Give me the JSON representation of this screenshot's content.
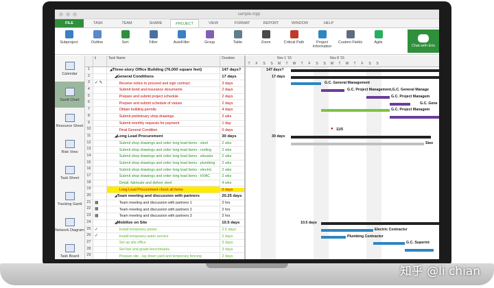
{
  "window": {
    "title": "sample.mpp"
  },
  "ribbon_tabs": [
    "FILE",
    "TASK",
    "TEAM",
    "SHARE",
    "PROJECT",
    "VIEW",
    "FORMAT",
    "REPORT",
    "WINDOW",
    "HELP"
  ],
  "active_tab": "PROJECT",
  "ribbon_buttons": [
    {
      "label": "Subproject",
      "icon": "subproject-icon"
    },
    {
      "label": "Outline",
      "icon": "outline-icon"
    },
    {
      "label": "Sort",
      "icon": "sort-icon"
    },
    {
      "label": "Filter",
      "icon": "filter-icon"
    },
    {
      "label": "AutoFilter",
      "icon": "autofilter-icon"
    },
    {
      "label": "Group",
      "icon": "group-icon"
    },
    {
      "label": "Table",
      "icon": "table-icon"
    },
    {
      "label": "Zoom",
      "icon": "zoom-icon"
    },
    {
      "label": "Critical Path",
      "icon": "critical-path-icon"
    },
    {
      "label": "Project Information",
      "icon": "project-info-icon"
    },
    {
      "label": "Custom Fields",
      "icon": "custom-fields-icon"
    },
    {
      "label": "Agile",
      "icon": "agile-icon"
    }
  ],
  "chat": {
    "label": "Chat with Eris"
  },
  "side_views": [
    "Calendar",
    "Gantt Chart",
    "Resource Sheet",
    "Risk View",
    "Task Sheet",
    "Tracking Gantt",
    "Network Diagram",
    "Task Board"
  ],
  "active_view": "Gantt Chart",
  "grid": {
    "col_task": "Task Name",
    "col_duration": "Duration",
    "rows": [
      {
        "id": "1",
        "name": "Three-story Office Building (76,000 square feet)",
        "duration": "147 days?",
        "style": "summary",
        "indent": 0
      },
      {
        "id": "2",
        "name": "General Conditions",
        "duration": "17 days",
        "style": "summary",
        "indent": 1
      },
      {
        "id": "3",
        "name": "Receive notice to proceed and sign contract",
        "duration": "3 days",
        "style": "red",
        "indent": 2
      },
      {
        "id": "4",
        "name": "Submit bond and insurance documents",
        "duration": "2 days",
        "style": "red",
        "indent": 2
      },
      {
        "id": "5",
        "name": "Prepare and submit project schedule",
        "duration": "2 days",
        "style": "red",
        "indent": 2
      },
      {
        "id": "6",
        "name": "Prepare and submit schedule of values",
        "duration": "2 days",
        "style": "red",
        "indent": 2
      },
      {
        "id": "7",
        "name": "Obtain building permits",
        "duration": "4 days",
        "style": "red",
        "indent": 2
      },
      {
        "id": "8",
        "name": "Submit preliminary shop drawings",
        "duration": "2 wks",
        "style": "red",
        "indent": 2
      },
      {
        "id": "9",
        "name": "Submit monthly requests for payment",
        "duration": "1 day",
        "style": "red",
        "indent": 2
      },
      {
        "id": "10",
        "name": "Final General Condition",
        "duration": "0 days",
        "style": "red",
        "indent": 2
      },
      {
        "id": "11",
        "name": "Long Lead Procurement",
        "duration": "30 days",
        "style": "summary",
        "indent": 1
      },
      {
        "id": "12",
        "name": "Submit shop drawings and order long lead items - steel",
        "duration": "2 wks",
        "style": "green",
        "indent": 2
      },
      {
        "id": "13",
        "name": "Submit shop drawings and order long lead items - roofing",
        "duration": "2 wks",
        "style": "green",
        "indent": 2
      },
      {
        "id": "14",
        "name": "Submit shop drawings and order long lead items - elevator",
        "duration": "2 wks",
        "style": "green",
        "indent": 2
      },
      {
        "id": "15",
        "name": "Submit shop drawings and order long lead items - plumbing",
        "duration": "2 wks",
        "style": "green",
        "indent": 2
      },
      {
        "id": "16",
        "name": "Submit shop drawings and order long lead items - electric",
        "duration": "2 wks",
        "style": "green",
        "indent": 2
      },
      {
        "id": "17",
        "name": "Submit shop drawings and order long lead items - HVAC",
        "duration": "2 wks",
        "style": "green",
        "indent": 2
      },
      {
        "id": "18",
        "name": "Detail, fabricate and deliver steel",
        "duration": "4 wks",
        "style": "green",
        "indent": 2
      },
      {
        "id": "19",
        "name": "Long Lead Procurement check all items",
        "duration": "0 days",
        "style": "highlight",
        "indent": 2
      },
      {
        "id": "20",
        "name": "Team meeting and discussion with partners",
        "duration": "20.25 days",
        "style": "summary",
        "indent": 1
      },
      {
        "id": "21",
        "name": "Team meeting and discussion with partners 1",
        "duration": "2 hrs",
        "style": "plain",
        "indent": 2
      },
      {
        "id": "22",
        "name": "Team meeting and discussion with partners 2",
        "duration": "2 hrs",
        "style": "plain",
        "indent": 2
      },
      {
        "id": "23",
        "name": "Team meeting and discussion with partners 3",
        "duration": "2 hrs",
        "style": "plain",
        "indent": 2
      },
      {
        "id": "24",
        "name": "Mobilize on Site",
        "duration": "10.5 days",
        "style": "summary",
        "indent": 1
      },
      {
        "id": "25",
        "name": "Install temporary power",
        "duration": "2.5 days",
        "style": "lime",
        "indent": 2
      },
      {
        "id": "26",
        "name": "Install temporary water service",
        "duration": "2 days",
        "style": "lime",
        "indent": 2
      },
      {
        "id": "27",
        "name": "Set up site office",
        "duration": "3 days",
        "style": "lime",
        "indent": 2
      },
      {
        "id": "28",
        "name": "Set line and grade benchmarks",
        "duration": "3 days",
        "style": "lime",
        "indent": 2
      },
      {
        "id": "29",
        "name": "Prepare site - lay down yard and temporary fencing",
        "duration": "2 days",
        "style": "lime",
        "indent": 2
      }
    ]
  },
  "timescale": {
    "weeks": [
      "Nov 1 '15",
      "Nov 8 '15"
    ],
    "days": [
      "T",
      "F",
      "S",
      "S",
      "M",
      "T",
      "W",
      "T",
      "F",
      "S",
      "S",
      "M",
      "T",
      "W",
      "T",
      "F",
      "S",
      "S"
    ]
  },
  "gantt_labels": {
    "r1": "147 days?",
    "r2": "17 days",
    "r3": "G.C. General Management",
    "r4": "G.C. Project Management,G.C. General Manage",
    "r5": "G.C. Project Managem",
    "r6": "G.C. Gene",
    "r7": "G.C. Project Managem",
    "r10": "11/5",
    "r11": "30 days",
    "r12": "Stee",
    "r24": "10.5 days",
    "r25": "Electric Contractor",
    "r26": "Plumbing Contractor",
    "r27": "G.C. Superint"
  },
  "watermark": "知乎 @li chian"
}
